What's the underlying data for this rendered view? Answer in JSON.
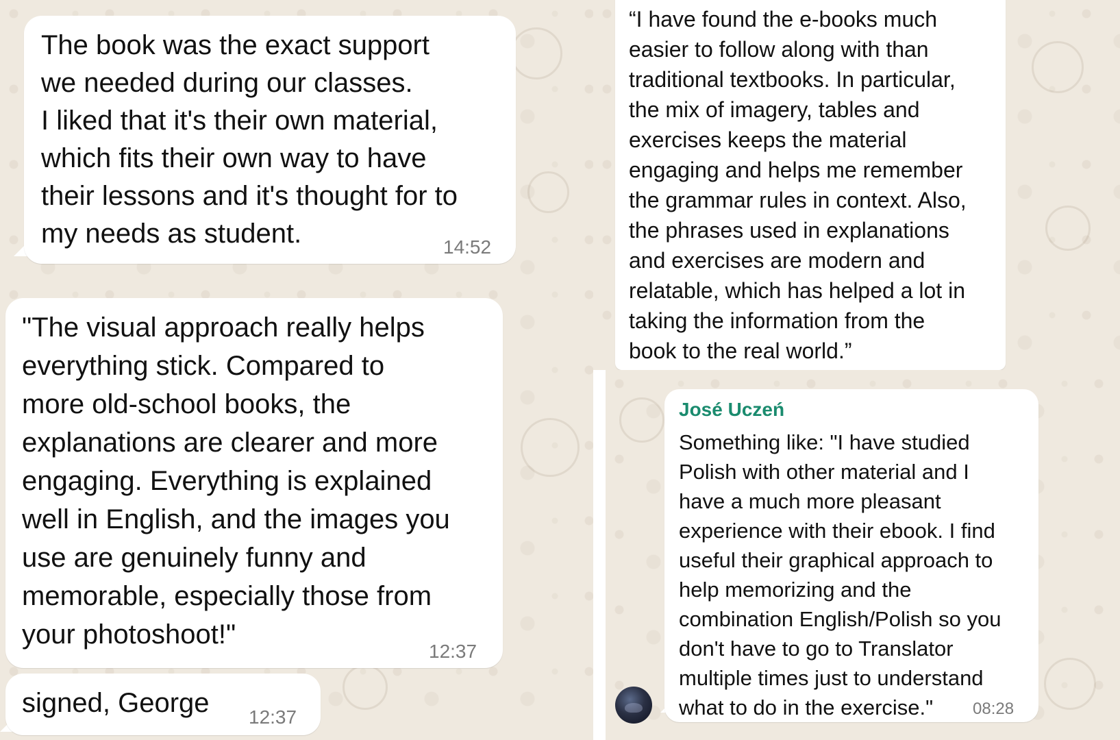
{
  "messages": {
    "book_support": {
      "text": "The book was the exact support\nwe needed during our classes.\nI liked that it's their own material,\nwhich fits their own way to have\ntheir lessons and it's thought for to\nmy needs as student.",
      "time": "14:52"
    },
    "visual_approach": {
      "text": "\"The visual approach really helps\neverything stick. Compared to\nmore old-school books, the\nexplanations are clearer and more\nengaging. Everything is explained\nwell in English, and the images you\nuse are genuinely funny and\nmemorable, especially those from\nyour photoshoot!\"",
      "time": "12:37"
    },
    "signed": {
      "text": "signed, George",
      "time": "12:37"
    },
    "ebooks": {
      "text": "“I have found the e-books much\neasier to follow along with than\ntraditional textbooks. In particular,\nthe mix of imagery, tables and\nexercises keeps the material\nengaging and helps me remember\nthe grammar rules in context. Also,\nthe phrases used in explanations\nand exercises are modern and\nrelatable, which has helped a lot in\ntaking the information from the\nbook to the real world.”"
    },
    "jose": {
      "sender": "José Uczeń",
      "text": "Something like: \"I have studied\nPolish with other material and I\nhave a much more pleasant\nexperience with their ebook. I find\nuseful their graphical approach to\nhelp memorizing and the\ncombination English/Polish so you\ndon't have to go to Translator\nmultiple times just to understand\nwhat to do in the exercise.\"",
      "time": "08:28"
    }
  },
  "colors": {
    "chat_background": "#efe9df",
    "bubble": "#ffffff",
    "sender_name": "#1a8b6e",
    "timestamp": "#7a7a7a"
  }
}
